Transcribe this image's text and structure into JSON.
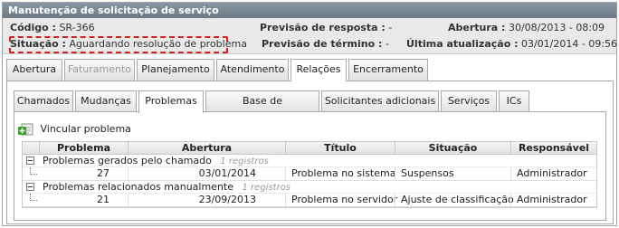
{
  "panel_title": "Manutenção de solicitação de serviço",
  "info": {
    "codigo_label": "Código :",
    "codigo_value": "SR-366",
    "previsao_resposta_label": "Previsão de resposta :",
    "previsao_resposta_value": "-",
    "abertura_label": "Abertura :",
    "abertura_value": "30/08/2013 - 08:09",
    "situacao_label": "Situação :",
    "situacao_value": "Aguardando resolução de problema",
    "previsao_termino_label": "Previsão de término :",
    "previsao_termino_value": "-",
    "ultima_atualizacao_label": "Última atualização :",
    "ultima_atualizacao_value": "03/01/2014 - 09:56"
  },
  "main_tabs": [
    "Abertura",
    "Faturamento",
    "Planejamento",
    "Atendimento",
    "Relações",
    "Encerramento"
  ],
  "sub_tabs": [
    "Chamados",
    "Mudanças",
    "Problemas",
    "Base de conhecimento",
    "Solicitantes adicionais",
    "Serviços",
    "ICs"
  ],
  "vincular_label": "Vincular problema",
  "columns": [
    "Problema",
    "Abertura",
    "Título",
    "Situação",
    "Responsável"
  ],
  "groups": [
    {
      "title": "Problemas gerados pelo chamado",
      "count": "1 registros",
      "rows": [
        {
          "problema": "27",
          "abertura": "03/01/2014",
          "titulo": "Problema no sistema",
          "situacao": "Suspensos",
          "responsavel": "Administrador"
        }
      ]
    },
    {
      "title": "Problemas relacionados manualmente",
      "count": "1 registros",
      "rows": [
        {
          "problema": "21",
          "abertura": "23/09/2013",
          "titulo": "Problema no servidor",
          "situacao": "Ajuste de classificação",
          "responsavel": "Administrador"
        }
      ]
    }
  ],
  "colors": {
    "title_bar": "#7a8692",
    "info_bg": "#e9e9e9",
    "highlight_border": "#d02020",
    "disabled_text": "#9a9a9a",
    "add_icon_green": "#3a9a2a"
  },
  "icons": {
    "vincular": "add-link-icon",
    "group_toggle": "collapse-icon"
  }
}
